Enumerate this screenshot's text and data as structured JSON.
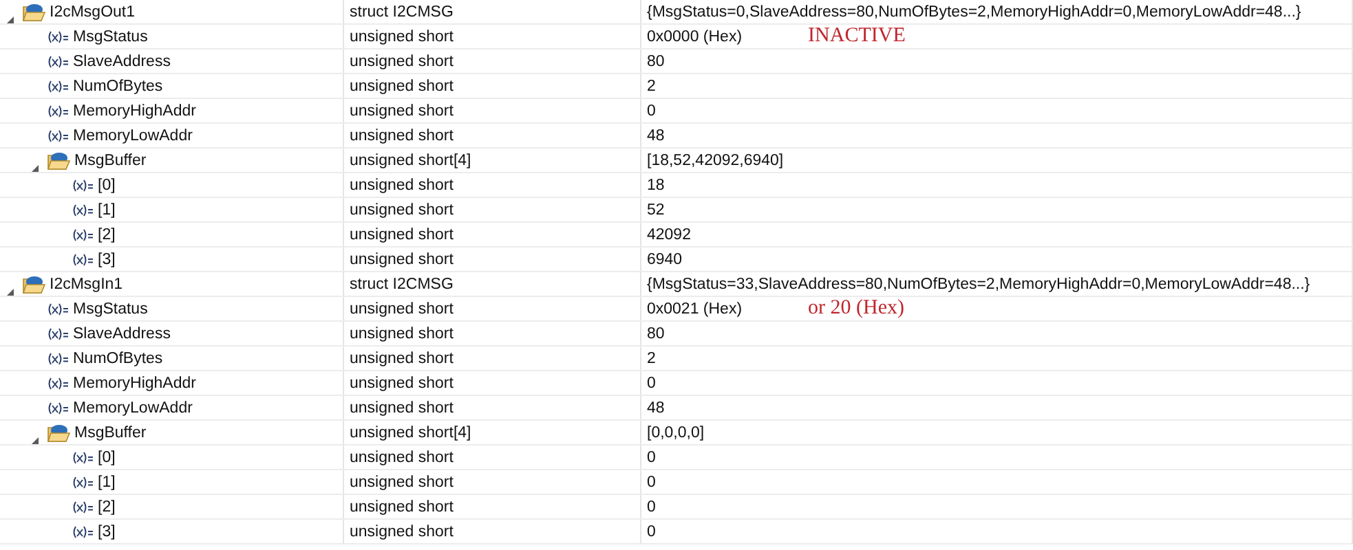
{
  "variables": [
    {
      "name": "I2cMsgOut1",
      "type": "struct I2CMSG",
      "value": "{MsgStatus=0,SlaveAddress=80,NumOfBytes=2,MemoryHighAddr=0,MemoryLowAddr=48...}",
      "kind": "struct",
      "expanded": true,
      "children": [
        {
          "name": "MsgStatus",
          "type": "unsigned short",
          "value": "0x0000 (Hex)",
          "kind": "scalar",
          "note": "INACTIVE"
        },
        {
          "name": "SlaveAddress",
          "type": "unsigned short",
          "value": "80",
          "kind": "scalar"
        },
        {
          "name": "NumOfBytes",
          "type": "unsigned short",
          "value": "2",
          "kind": "scalar"
        },
        {
          "name": "MemoryHighAddr",
          "type": "unsigned short",
          "value": "0",
          "kind": "scalar"
        },
        {
          "name": "MemoryLowAddr",
          "type": "unsigned short",
          "value": "48",
          "kind": "scalar"
        },
        {
          "name": "MsgBuffer",
          "type": "unsigned short[4]",
          "value": "[18,52,42092,6940]",
          "kind": "struct",
          "expanded": true,
          "children": [
            {
              "name": "[0]",
              "type": "unsigned short",
              "value": "18",
              "kind": "scalar"
            },
            {
              "name": "[1]",
              "type": "unsigned short",
              "value": "52",
              "kind": "scalar"
            },
            {
              "name": "[2]",
              "type": "unsigned short",
              "value": "42092",
              "kind": "scalar"
            },
            {
              "name": "[3]",
              "type": "unsigned short",
              "value": "6940",
              "kind": "scalar"
            }
          ]
        }
      ]
    },
    {
      "name": "I2cMsgIn1",
      "type": "struct I2CMSG",
      "value": "{MsgStatus=33,SlaveAddress=80,NumOfBytes=2,MemoryHighAddr=0,MemoryLowAddr=48...}",
      "kind": "struct",
      "expanded": true,
      "children": [
        {
          "name": "MsgStatus",
          "type": "unsigned short",
          "value": "0x0021 (Hex)",
          "kind": "scalar",
          "note": "or 20 (Hex)"
        },
        {
          "name": "SlaveAddress",
          "type": "unsigned short",
          "value": "80",
          "kind": "scalar"
        },
        {
          "name": "NumOfBytes",
          "type": "unsigned short",
          "value": "2",
          "kind": "scalar"
        },
        {
          "name": "MemoryHighAddr",
          "type": "unsigned short",
          "value": "0",
          "kind": "scalar"
        },
        {
          "name": "MemoryLowAddr",
          "type": "unsigned short",
          "value": "48",
          "kind": "scalar"
        },
        {
          "name": "MsgBuffer",
          "type": "unsigned short[4]",
          "value": "[0,0,0,0]",
          "kind": "struct",
          "expanded": true,
          "children": [
            {
              "name": "[0]",
              "type": "unsigned short",
              "value": "0",
              "kind": "scalar"
            },
            {
              "name": "[1]",
              "type": "unsigned short",
              "value": "0",
              "kind": "scalar"
            },
            {
              "name": "[2]",
              "type": "unsigned short",
              "value": "0",
              "kind": "scalar"
            },
            {
              "name": "[3]",
              "type": "unsigned short",
              "value": "0",
              "kind": "scalar"
            }
          ]
        }
      ]
    }
  ]
}
